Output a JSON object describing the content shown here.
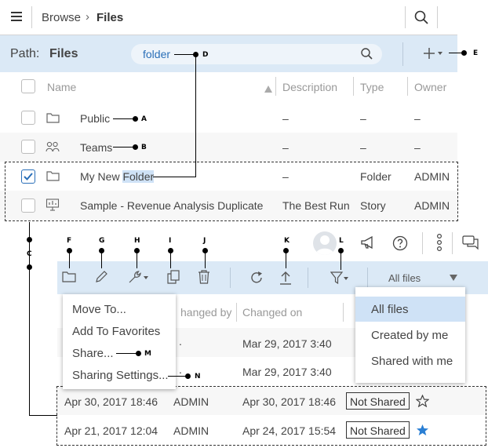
{
  "header": {
    "breadcrumb_browse": "Browse",
    "breadcrumb_sep": "›",
    "breadcrumb_files": "Files"
  },
  "pathbar": {
    "label": "Path:",
    "value": "Files",
    "search_value": "folder"
  },
  "table": {
    "columns": {
      "name": "Name",
      "description": "Description",
      "type": "Type",
      "owner": "Owner"
    },
    "rows": [
      {
        "name": "Public",
        "description": "–",
        "type": "–",
        "owner": "–"
      },
      {
        "name": "Teams",
        "description": "–",
        "type": "–",
        "owner": "–"
      },
      {
        "name_prefix": "My New ",
        "name_highlight": "Folder",
        "description": "–",
        "type": "Folder",
        "owner": "ADMIN"
      },
      {
        "name": "Sample - Revenue Analysis Duplicate",
        "description": "The Best Run",
        "type": "Story",
        "owner": "ADMIN"
      }
    ]
  },
  "toolbar2": {
    "filter_select": "All files"
  },
  "lower_table": {
    "columns": {
      "changed_by": "hanged by",
      "changed_on": "Changed on"
    },
    "rows": [
      {
        "created": "",
        "changed_by": "",
        "changed_on": "Mar 29, 2017 3:40",
        "prefix": "."
      },
      {
        "created": "",
        "changed_by": "",
        "changed_on": "Mar 29, 2017 3:40",
        "prefix": "."
      },
      {
        "created": "Apr 30, 2017 18:46",
        "changed_by": "ADMIN",
        "changed_on": "Apr 30, 2017 18:46",
        "shared": "Not Shared",
        "favorite": false
      },
      {
        "created": "Apr 21, 2017 12:04",
        "changed_by": "ADMIN",
        "changed_on": "Apr 24, 2017 15:54",
        "shared": "Not Shared",
        "favorite": true
      }
    ]
  },
  "context_menu": {
    "items": [
      "Move To...",
      "Add To Favorites",
      "Share...",
      "Sharing Settings..."
    ]
  },
  "filter_menu": {
    "items": [
      "All files",
      "Created by me",
      "Shared with me"
    ],
    "selected": "All files"
  },
  "callouts": {
    "A": "A",
    "B": "B",
    "C": "C",
    "D": "D",
    "E": "E",
    "F": "F",
    "G": "G",
    "H": "H",
    "I": "I",
    "J": "J",
    "K": "K",
    "L": "L",
    "M": "M",
    "N": "N"
  },
  "colors": {
    "accent": "#2a6fb8",
    "pathbar": "#dbe9f6",
    "highlight": "#cfe2f6",
    "star": "#2a7fd4"
  }
}
